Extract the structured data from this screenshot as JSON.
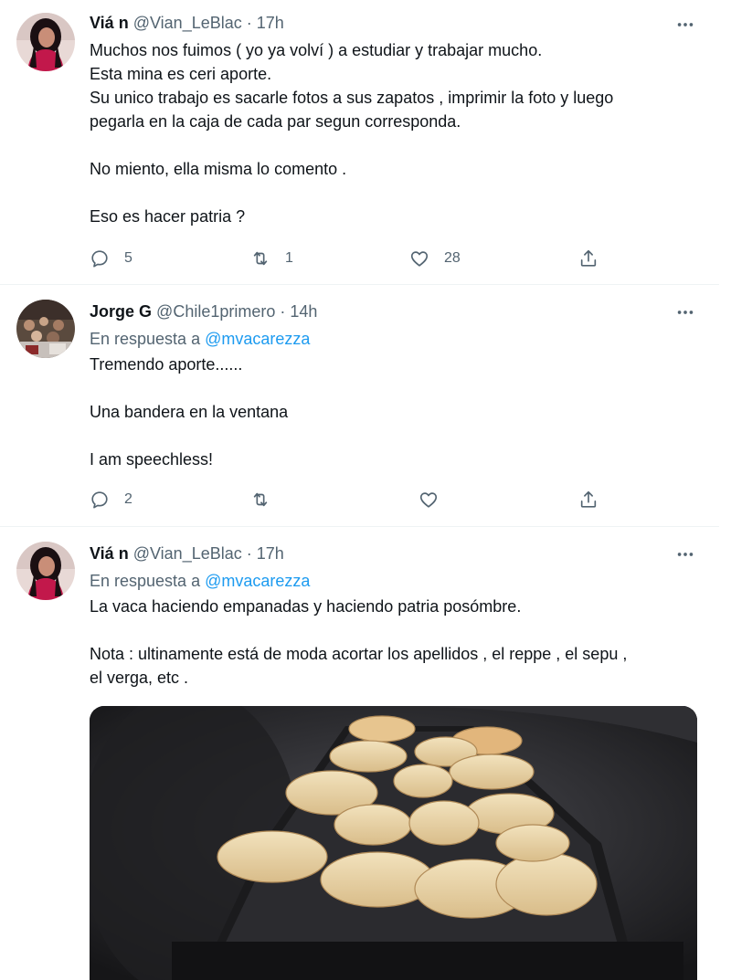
{
  "tweets": [
    {
      "name": "Viá n",
      "handle": "@Vian_LeBlac",
      "dot": "·",
      "time": "17h",
      "body": [
        "Muchos nos fuimos ( yo ya volví ) a estudiar y trabajar mucho.",
        "Esta mina es ceri aporte.",
        "Su unico trabajo es sacarle fotos a sus zapatos , imprimir la foto y luego",
        "pegarla en la caja de cada par segun corresponda.",
        "",
        "No miento, ella misma lo comento .",
        "",
        "Eso es hacer patria ?"
      ],
      "replies": "5",
      "retweets": "1",
      "likes": "28"
    },
    {
      "name": "Jorge G",
      "handle": "@Chile1primero",
      "dot": "·",
      "time": "14h",
      "reply_prefix": "En respuesta a",
      "reply_mention": "@mvacarezza",
      "body": [
        "Tremendo aporte......",
        "",
        "Una bandera en la ventana",
        "",
        "I am speechless!"
      ],
      "replies": "2"
    },
    {
      "name": "Viá n",
      "handle": "@Vian_LeBlac",
      "dot": "·",
      "time": "17h",
      "reply_prefix": "En respuesta a",
      "reply_mention": "@mvacarezza",
      "body": [
        "La vaca haciendo empanadas y haciendo patria posómbre.",
        "",
        "Nota : ultinamente está de moda acortar los apellidos , el reppe , el sepu ,",
        "el verga, etc ."
      ]
    }
  ],
  "icons": {
    "reply": "reply-icon",
    "retweet": "retweet-icon",
    "like": "heart-icon",
    "share": "share-icon",
    "more": "more-icon"
  },
  "colors": {
    "text": "#0f1419",
    "secondary": "#536471",
    "link": "#1d9bf0",
    "divider": "#eff3f4"
  }
}
